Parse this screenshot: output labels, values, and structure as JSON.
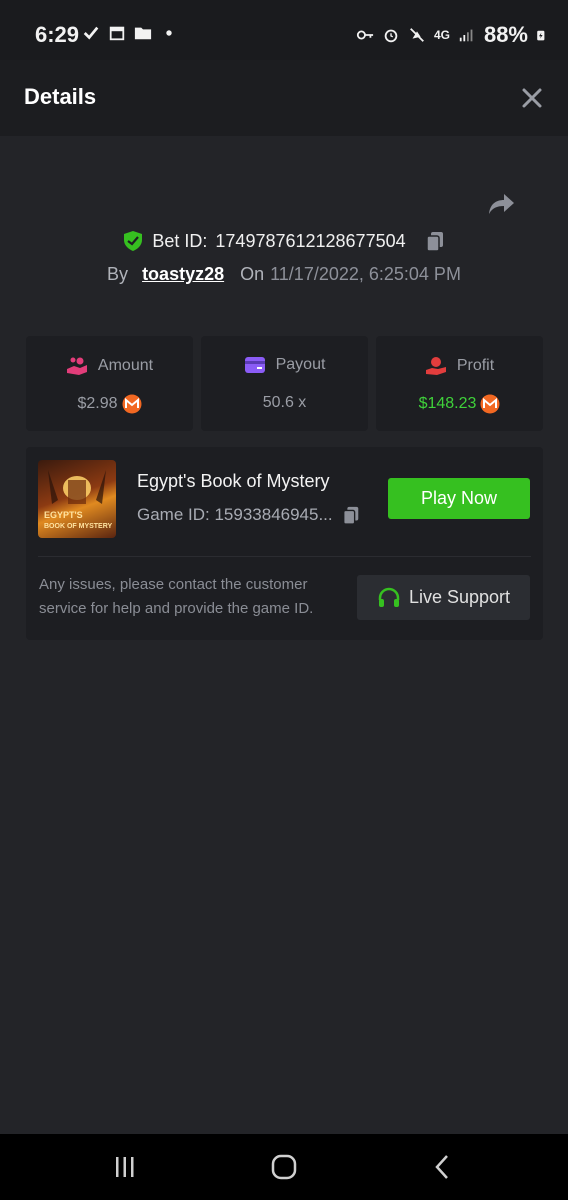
{
  "status_bar": {
    "time": "6:29",
    "battery": "88%",
    "network": "4G"
  },
  "header": {
    "title": "Details"
  },
  "bet": {
    "id_label": "Bet ID:",
    "id_value": "1749787612128677504",
    "by_label": "By",
    "username": "toastyz28",
    "on_label": "On",
    "date": "11/17/2022, 6:25:04 PM"
  },
  "stats": {
    "amount": {
      "label": "Amount",
      "value": "$2.98"
    },
    "payout": {
      "label": "Payout",
      "value": "50.6 x"
    },
    "profit": {
      "label": "Profit",
      "value": "$148.23"
    }
  },
  "game": {
    "title": "Egypt's Book of Mystery",
    "id_text": "Game ID: 15933846945...",
    "thumb_line1": "EGYPT'S",
    "thumb_line2": "BOOK OF MYSTERY",
    "play_label": "Play Now",
    "help_text": "Any issues, please contact the customer service for help and provide the game ID.",
    "support_label": "Live Support"
  },
  "colors": {
    "accent_green": "#36c020",
    "profit_green": "#3fd13a",
    "amount_pink": "#e23d7a",
    "payout_purple": "#8b5cf6",
    "profit_red": "#e23d3d",
    "coin_orange": "#f26822"
  },
  "icons": {
    "close": "close-icon",
    "share": "share-icon",
    "shield": "shield-check-icon",
    "copy": "copy-icon",
    "amount": "coins-hand-icon",
    "payout": "card-icon",
    "profit": "profit-hand-icon",
    "coin": "monero-coin-icon",
    "support": "headset-icon"
  }
}
